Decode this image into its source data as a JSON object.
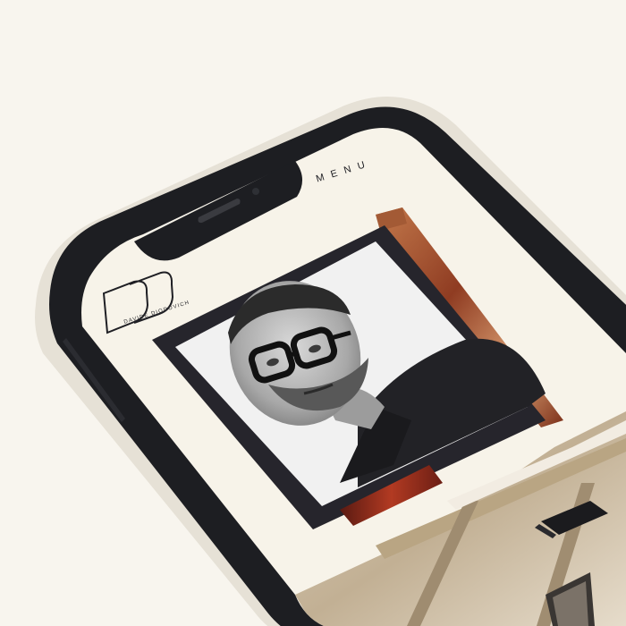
{
  "app": {
    "nav": {
      "menu_label": "MENU"
    },
    "brand": {
      "monogram": "DD",
      "name": "DAVIDE DIODOVICH"
    },
    "hero": {
      "portrait": "black-and-white portrait of man with glasses"
    }
  },
  "colors": {
    "background": "#f8f5ee",
    "phone_frame": "#1d1e22",
    "screen_bg": "#f7f3e9",
    "frame_dark": "#26252c",
    "accent_copper": "#9a4a2b"
  }
}
